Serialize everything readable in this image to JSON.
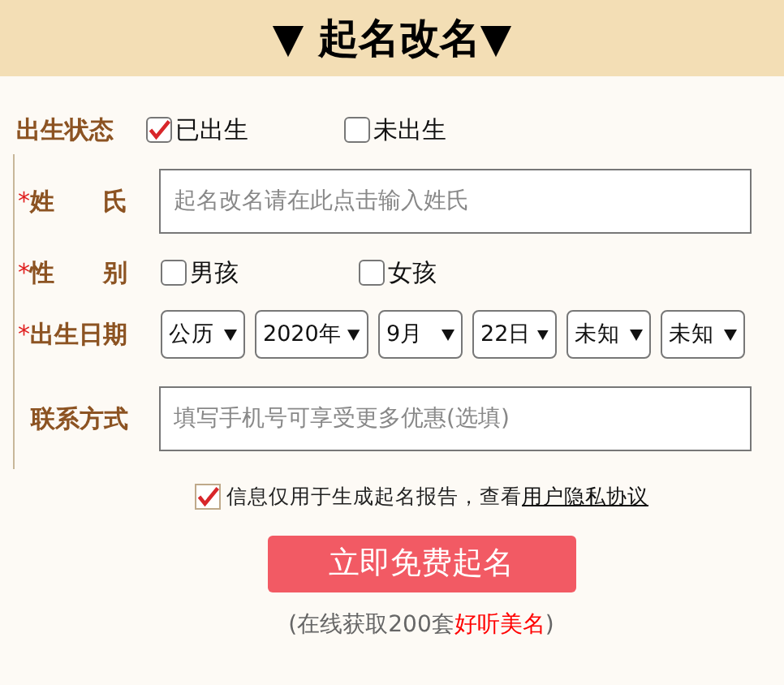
{
  "header": {
    "title": "▼ 起名改名▼"
  },
  "form": [
    {
      "kind": "choice",
      "label": "出生状态",
      "options": [
        {
          "label": "已出生",
          "selected": true
        },
        {
          "label": "未出生",
          "selected": false
        }
      ]
    },
    {
      "kind": "text",
      "label": "姓　　氏",
      "mark": "*",
      "placeholder": "起名改名请在此点击输入姓氏"
    },
    {
      "kind": "choice",
      "label": "性　　别",
      "mark": "*",
      "options": [
        {
          "label": "男孩",
          "selected": false
        },
        {
          "label": "女孩",
          "selected": false
        }
      ]
    },
    {
      "kind": "selects",
      "label": "出生日期",
      "mark": "*",
      "selects": [
        "公历",
        "2020年",
        "9月",
        "22日",
        "未知",
        "未知"
      ]
    },
    {
      "kind": "text",
      "label": "联系方式",
      "placeholder": "填写手机号可享受更多优惠(选填)"
    }
  ],
  "consent": {
    "checked": true,
    "text": "信息仅用于生成起名报告，查看",
    "link": "用户隐私协议"
  },
  "submit": "立即免费起名",
  "note": [
    {
      "text": "(在线获取200套",
      "highlight": false
    },
    {
      "text": "好听美名",
      "highlight": true
    },
    {
      "text": ")",
      "highlight": false
    }
  ]
}
